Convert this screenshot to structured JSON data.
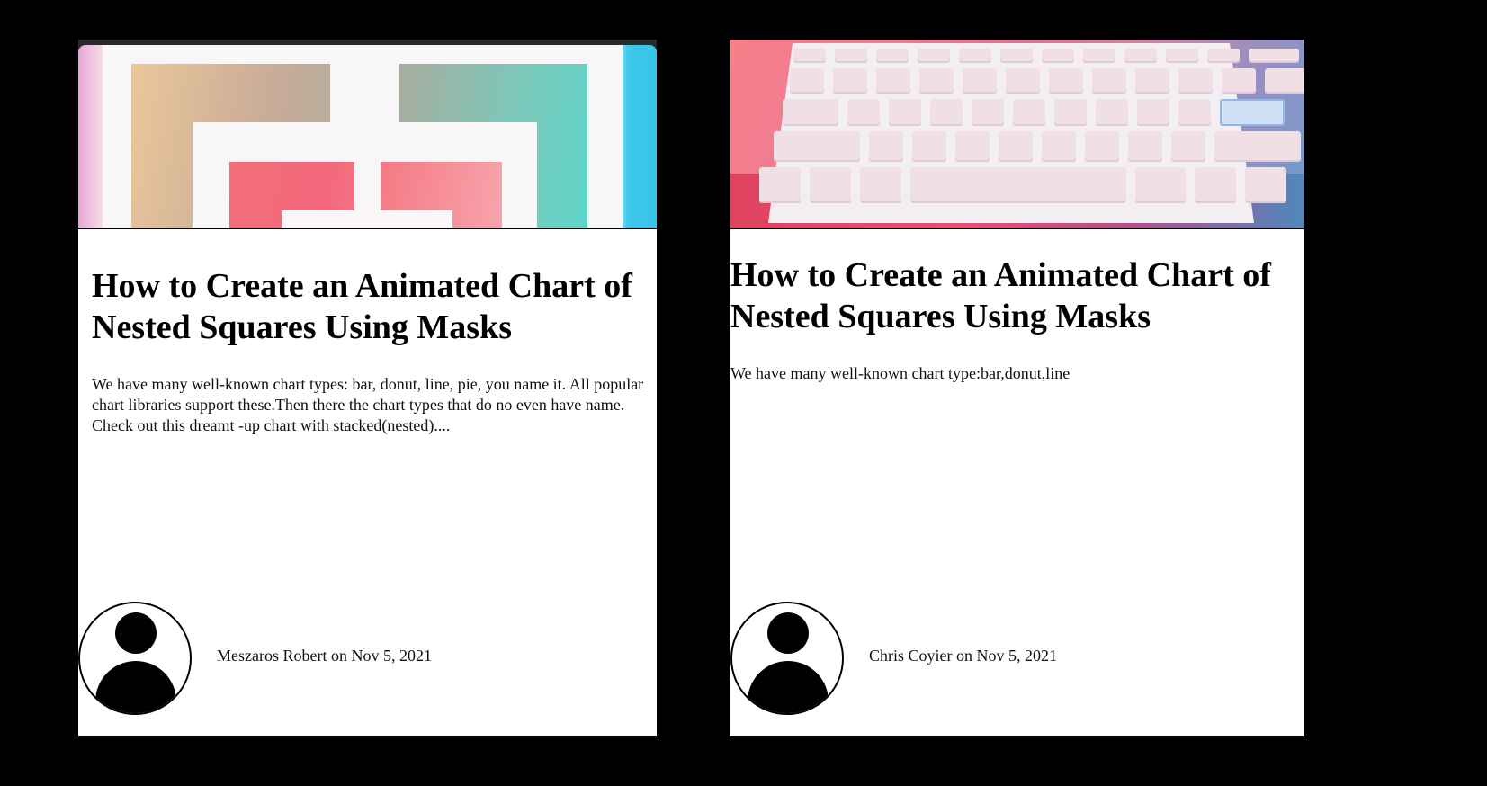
{
  "cards": [
    {
      "title": "How to Create an Animated Chart of Nested Squares Using Masks",
      "excerpt": "We have many well-known chart types: bar, donut, line, pie, you name it. All popular chart libraries support these.Then there the chart types that do no even have name. Check out this dreamt -up chart with stacked(nested)....",
      "author": "Meszaros Robert",
      "date_connector": "on",
      "date": "Nov 5, 2021",
      "byline": "Meszaros Robert on Nov 5, 2021",
      "image": "nested-squares-illustration",
      "avatar_icon": "user-avatar-icon"
    },
    {
      "title": "How to Create an Animated Chart of Nested Squares Using Masks",
      "excerpt": "We have many well-known chart type:bar,donut,line",
      "author": "Chris Coyier",
      "date_connector": "on",
      "date": "Nov 5, 2021",
      "byline": "Chris Coyier on Nov 5, 2021",
      "image": "keyboard-illustration",
      "avatar_icon": "user-avatar-icon"
    }
  ],
  "colors": {
    "page_background": "#000000",
    "card_background": "#ffffff",
    "text": "#000000"
  }
}
